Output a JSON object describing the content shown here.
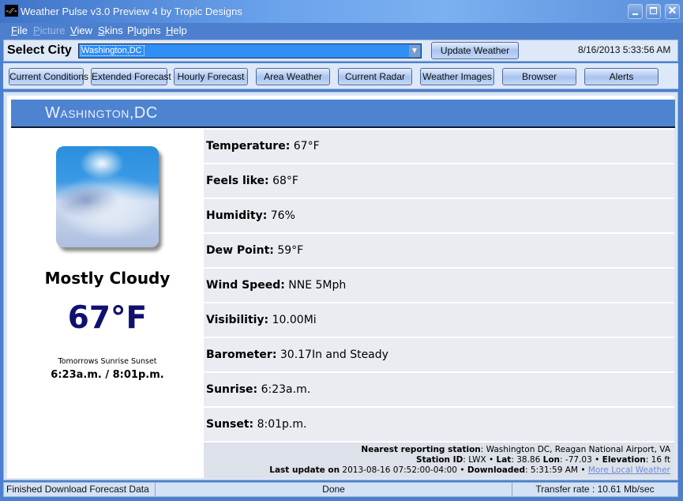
{
  "window": {
    "title": "Weather Pulse v3.0 Preview 4 by Tropic Designs",
    "app_icon": "pulse-icon",
    "controls": [
      "minimize",
      "maximize",
      "close"
    ]
  },
  "menu": [
    {
      "label": "File",
      "accel": "F",
      "rest": "ile",
      "disabled": false
    },
    {
      "label": "Picture",
      "accel": "P",
      "rest": "icture",
      "disabled": true
    },
    {
      "label": "View",
      "accel": "V",
      "rest": "iew",
      "disabled": false
    },
    {
      "label": "Skins",
      "accel": "S",
      "rest": "kins",
      "disabled": false
    },
    {
      "label": "Plugins",
      "accel": "Pl",
      "rest": "ugins",
      "disabled": false
    },
    {
      "label": "Help",
      "accel": "H",
      "rest": "elp",
      "disabled": false
    }
  ],
  "toolbar": {
    "select_city_label": "Select City",
    "city_value": "Washington,DC",
    "update_button": "Update Weather",
    "datetime": "8/16/2013 5:33:56 AM"
  },
  "nav": [
    "Current Conditions",
    "Extended Forecast",
    "Hourly Forecast",
    "Area Weather",
    "Current Radar",
    "Weather Images",
    "Browser",
    "Alerts"
  ],
  "current": {
    "city": "Washington,DC",
    "icon": "mostly-cloudy-icon",
    "condition": "Mostly Cloudy",
    "temperature": "67°F",
    "sun_label": "Tomorrows Sunrise Sunset",
    "sun_times": "6:23a.m. / 8:01p.m."
  },
  "details": [
    {
      "label": "Temperature:",
      "value": "67°F"
    },
    {
      "label": "Feels like:",
      "value": "68°F"
    },
    {
      "label": "Humidity:",
      "value": "76%"
    },
    {
      "label": "Dew Point:",
      "value": "59°F"
    },
    {
      "label": "Wind Speed:",
      "value": "NNE 5Mph"
    },
    {
      "label": "Visibilitiy:",
      "value": "10.00Mi"
    },
    {
      "label": "Barometer:",
      "value": "30.17In and Steady"
    },
    {
      "label": "Sunrise:",
      "value": "6:23a.m."
    },
    {
      "label": "Sunset:",
      "value": "8:01p.m."
    }
  ],
  "station": {
    "nearest_label": "Nearest reporting station",
    "nearest_value": "Washington DC, Reagan National Airport, VA",
    "id_label": "Station ID",
    "id_value": "LWX",
    "lat_label": "Lat",
    "lat_value": "38.86",
    "lon_label": "Lon",
    "lon_value": "-77.03",
    "elev_label": "Elevation",
    "elev_value": "16 ft",
    "last_update_label": "Last update on",
    "last_update_value": "2013-08-16 07:52:00-04:00",
    "downloaded_label": "Downloaded",
    "downloaded_value": "5:31:59 AM",
    "more_link": "More Local Weather"
  },
  "status": {
    "left": "Finished Download Forecast Data",
    "middle": "Done",
    "right": "Transfer rate : 10.61 Mb/sec"
  }
}
